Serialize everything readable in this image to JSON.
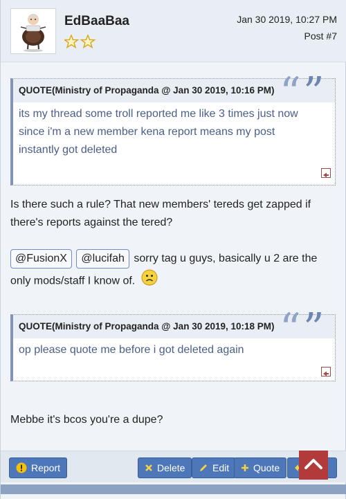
{
  "post": {
    "username": "EdBaaBaa",
    "date": "Jan 30 2019, 10:27 PM",
    "number": "Post #7"
  },
  "quotes": [
    {
      "title": "QUOTE(Ministry of Propaganda @ Jan 30 2019, 10:16 PM)",
      "lines": [
        "its my thread some troll reported me like 3 times just now",
        "since i'm a new member kena report means my post",
        "instantly got deleted"
      ]
    },
    {
      "title": "QUOTE(Ministry of Propaganda @ Jan 30 2019, 10:18 PM)",
      "lines": [
        "op please quote me before i got deleted again"
      ]
    }
  ],
  "body": {
    "paragraph1_line1": "Is there such a rule? That new members' tereds get zapped if",
    "paragraph1_line2": "there's reports against the tered?",
    "mention1": "@FusionX",
    "mention2": "@lucifah",
    "mention_text1": " sorry tag u guys, basically u 2 are the",
    "mention_text2": "only mods/staff I know of.",
    "closing": "Mebbe it's bcos you're a dupe?"
  },
  "actions": {
    "report": "Report",
    "delete": "Delete",
    "edit": "Edit",
    "quote": "Quote"
  },
  "colors": {
    "button": "#4d77b8",
    "scroll_top": "#b33a3a",
    "quote_text": "#4a5e88"
  },
  "icons": {
    "report": "warning-icon",
    "delete": "close-icon",
    "edit": "pencil-icon",
    "quote": "plus-icon",
    "scroll_top": "chevron-up-icon"
  }
}
